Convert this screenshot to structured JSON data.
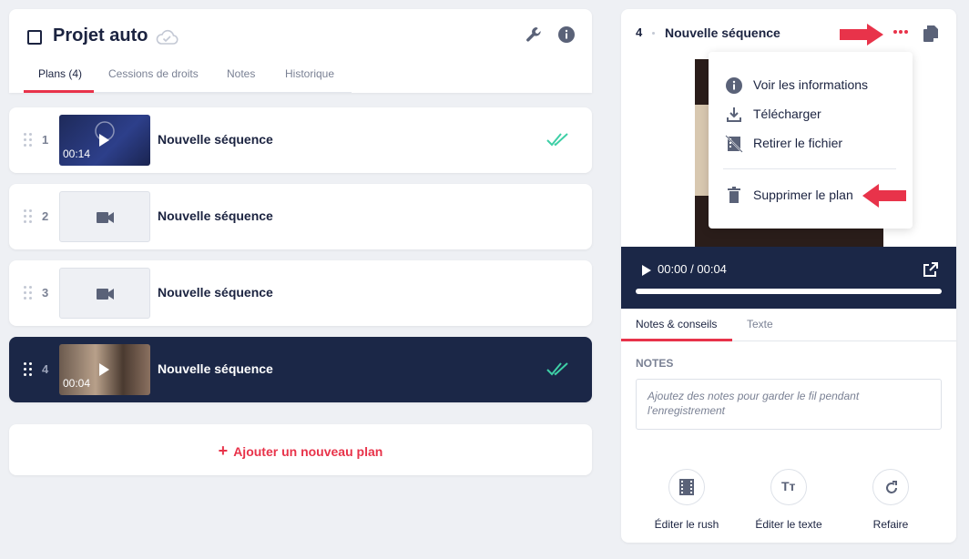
{
  "project": {
    "title": "Projet auto"
  },
  "tabs": [
    "Plans (4)",
    "Cessions de droits",
    "Notes",
    "Historique"
  ],
  "plans": [
    {
      "num": "1",
      "title": "Nouvelle séquence",
      "duration": "00:14"
    },
    {
      "num": "2",
      "title": "Nouvelle séquence",
      "duration": ""
    },
    {
      "num": "3",
      "title": "Nouvelle séquence",
      "duration": ""
    },
    {
      "num": "4",
      "title": "Nouvelle séquence",
      "duration": "00:04"
    }
  ],
  "add_plan_label": "Ajouter un nouveau plan",
  "detail": {
    "num": "4",
    "title": "Nouvelle séquence",
    "player_time": "00:00 / 00:04",
    "progress": 0,
    "tabs": [
      "Notes & conseils",
      "Texte"
    ],
    "notes_label": "NOTES",
    "notes_placeholder": "Ajoutez des notes pour garder le fil pendant l'enregistrement",
    "actions": [
      "Éditer le rush",
      "Éditer le texte",
      "Refaire"
    ]
  },
  "menu": {
    "items": [
      "Voir les informations",
      "Télécharger",
      "Retirer le fichier"
    ],
    "delete": "Supprimer le plan"
  },
  "colors": {
    "accent": "#e8334a",
    "navy": "#1b2747",
    "check": "#3ecfa6"
  }
}
